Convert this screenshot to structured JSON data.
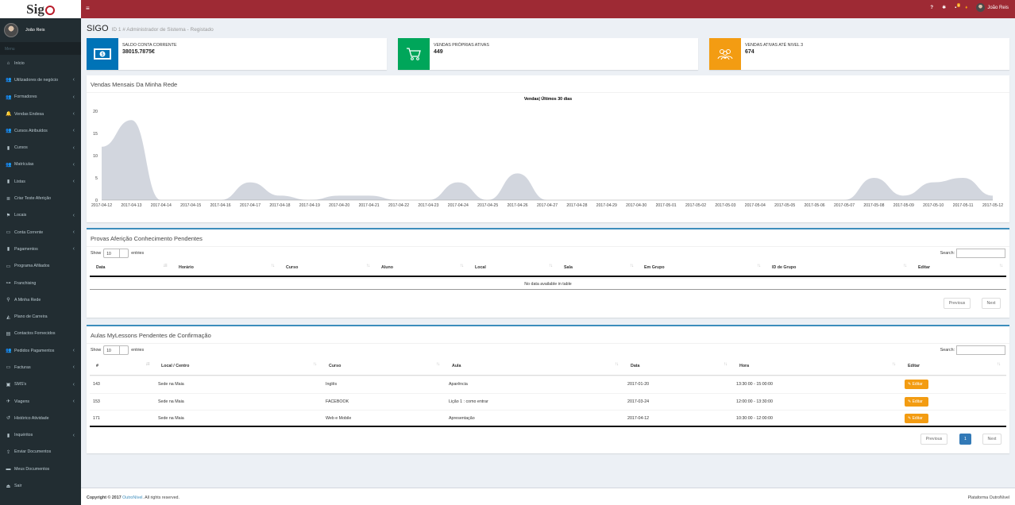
{
  "logo": {
    "text": "Sig"
  },
  "sidebar": {
    "user_name": "João Reis",
    "menu_label": "Menu",
    "items": [
      {
        "label": "Início",
        "icon": "home-icon",
        "glyph": "⌂",
        "chevron": false
      },
      {
        "label": "Utilizadores de negócio",
        "icon": "users-icon",
        "glyph": "👥",
        "chevron": true
      },
      {
        "label": "Formadores",
        "icon": "users-icon",
        "glyph": "👥",
        "chevron": true
      },
      {
        "label": "Vendas Endesa",
        "icon": "bell-icon",
        "glyph": "🔔",
        "chevron": true
      },
      {
        "label": "Cursos Atribuídos",
        "icon": "users-icon",
        "glyph": "👥",
        "chevron": true
      },
      {
        "label": "Cursos",
        "icon": "book-icon",
        "glyph": "▮",
        "chevron": true
      },
      {
        "label": "Matrículas",
        "icon": "users-icon",
        "glyph": "👥",
        "chevron": true
      },
      {
        "label": "Listas",
        "icon": "book-icon",
        "glyph": "▮",
        "chevron": true
      },
      {
        "label": "Criar Teste Aferição",
        "icon": "list-icon",
        "glyph": "≣",
        "chevron": false
      },
      {
        "label": "Locais",
        "icon": "map-marker-icon",
        "glyph": "⚑",
        "chevron": true
      },
      {
        "label": "Conta Corrente",
        "icon": "credit-card-icon",
        "glyph": "▭",
        "chevron": true
      },
      {
        "label": "Pagamentos",
        "icon": "book-icon",
        "glyph": "▮",
        "chevron": true
      },
      {
        "label": "Programa Afiliados",
        "icon": "money-icon",
        "glyph": "▭",
        "chevron": false
      },
      {
        "label": "Franchising",
        "icon": "handshake-icon",
        "glyph": "⊶",
        "chevron": false
      },
      {
        "label": "A Minha Rede",
        "icon": "sitemap-icon",
        "glyph": "⚲",
        "chevron": false
      },
      {
        "label": "Plano de Carreira",
        "icon": "graduation-icon",
        "glyph": "◭",
        "chevron": false
      },
      {
        "label": "Contactos Fornecidos",
        "icon": "contacts-icon",
        "glyph": "▤",
        "chevron": false
      },
      {
        "label": "Pedidos Pagamentos",
        "icon": "users-icon",
        "glyph": "👥",
        "chevron": true
      },
      {
        "label": "Facturas",
        "icon": "money-icon",
        "glyph": "▭",
        "chevron": true
      },
      {
        "label": "SMS's",
        "icon": "comments-icon",
        "glyph": "▣",
        "chevron": true
      },
      {
        "label": "Viagens",
        "icon": "plane-icon",
        "glyph": "✈",
        "chevron": true
      },
      {
        "label": "Histórico Atividade",
        "icon": "history-icon",
        "glyph": "↺",
        "chevron": false
      },
      {
        "label": "Inquéritos",
        "icon": "book-icon",
        "glyph": "▮",
        "chevron": true
      },
      {
        "label": "Enviar Documentos",
        "icon": "upload-icon",
        "glyph": "⇪",
        "chevron": false
      },
      {
        "label": "Meus Documentos",
        "icon": "folder-icon",
        "glyph": "▬",
        "chevron": false
      },
      {
        "label": "Sair",
        "icon": "logout-icon",
        "glyph": "⏏",
        "chevron": false
      }
    ]
  },
  "topbar": {
    "menu_glyph": "≡",
    "help": "?",
    "gear": "✱",
    "chat": "▪",
    "chat_badge": "0",
    "flag": "♦",
    "user_name": "João Reis"
  },
  "page": {
    "title": "SIGO",
    "subtitle": "ID 1 # Administrador de Sistema - Registado"
  },
  "info_boxes": [
    {
      "label": "SALDO CONTA CORRENTE",
      "value": "38015.7875€",
      "color": "#0073b7",
      "icon": "money-bill-icon"
    },
    {
      "label": "VENDAS PRÓPRIAS ATIVAS",
      "value": "449",
      "color": "#00a65a",
      "icon": "shopping-cart-icon"
    },
    {
      "label": "VENDAS ATIVAS ATÉ NIVEL 3",
      "value": "674",
      "color": "#f39c12",
      "icon": "users-group-icon"
    }
  ],
  "sales_box": {
    "title": "Vendas Mensais Da Minha Rede"
  },
  "chart_data": {
    "type": "area",
    "title": "Vendas| Últimos 30 dias",
    "xlabel": "",
    "ylabel": "",
    "ylim": [
      0,
      20
    ],
    "yticks": [
      0,
      5,
      10,
      15,
      20
    ],
    "categories": [
      "2017-04-12",
      "2017-04-13",
      "2017-04-14",
      "2017-04-15",
      "2017-04-16",
      "2017-04-17",
      "2017-04-18",
      "2017-04-19",
      "2017-04-20",
      "2017-04-21",
      "2017-04-22",
      "2017-04-23",
      "2017-04-24",
      "2017-04-25",
      "2017-04-26",
      "2017-04-27",
      "2017-04-28",
      "2017-04-29",
      "2017-04-30",
      "2017-05-01",
      "2017-05-02",
      "2017-05-03",
      "2017-05-04",
      "2017-05-05",
      "2017-05-06",
      "2017-05-07",
      "2017-05-08",
      "2017-05-09",
      "2017-05-10",
      "2017-05-11",
      "2017-05-12"
    ],
    "values": [
      12,
      18,
      0,
      0,
      0,
      4,
      1,
      0,
      1,
      1,
      0,
      0,
      4,
      0,
      6,
      0,
      0,
      0,
      0,
      0,
      0,
      0,
      0,
      0,
      0,
      0,
      5,
      1,
      4,
      5,
      1
    ],
    "fill": "#d2d6de",
    "grid": false
  },
  "provas": {
    "title": "Provas Aferição Conhecimento Pendentes",
    "show": "Show",
    "length": "10",
    "entries": "entries",
    "search": "Search:",
    "columns": [
      "Data",
      "Horário",
      "Curso",
      "Aluno",
      "Local",
      "Sala",
      "Em Grupo",
      "ID de Grupo",
      "Editar"
    ],
    "empty": "No data available in table",
    "prev": "Previous",
    "next": "Next"
  },
  "aulas": {
    "title": "Aulas MyLessons Pendentes de Confirmação",
    "show": "Show",
    "length": "10",
    "entries": "entries",
    "search": "Search:",
    "columns": [
      "#",
      "Local / Centro",
      "Curso",
      "Aula",
      "Data",
      "Hora",
      "Editar"
    ],
    "rows": [
      [
        "143",
        "Sede na Maia",
        "Inglês",
        "Aparência",
        "2017-01-20",
        "13:30:00 - 15:00:00",
        "✎ Editar"
      ],
      [
        "153",
        "Sede na Maia",
        "FACEBOOK",
        "Lição 1 : como entrar",
        "2017-03-24",
        "12:00:00 - 13:30:00",
        "✎ Editar"
      ],
      [
        "171",
        "Sede na Maia",
        "Web e Mobile",
        "Apresentação",
        "2017-04-12",
        "10:30:00 - 12:00:00",
        "✎ Editar"
      ]
    ],
    "prev": "Previous",
    "page": "1",
    "next": "Next"
  },
  "footer": {
    "copyright": "Copyright © 2017",
    "brand": "OutroNível",
    "rights": ". All rights reserved.",
    "platform": "Plataforma OutroNível"
  }
}
